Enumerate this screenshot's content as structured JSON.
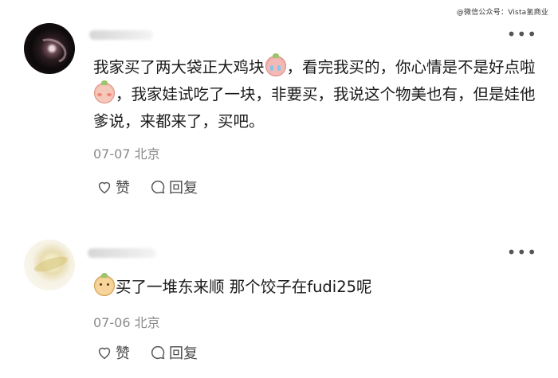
{
  "watermark": "@微信公众号：Vista氢商业",
  "comments": [
    {
      "text_parts": [
        "我家买了两大袋正大鸡块",
        "，看完我买的，你心情是不是好点啦",
        "，我家娃试吃了一块，非要买，我说这个物美也有，但是娃他爹说，来都来了，买吧。"
      ],
      "meta": "07-07 北京",
      "like_label": "赞",
      "reply_label": "回复"
    },
    {
      "text_parts": [
        "买了一堆东来顺 那个饺子在fudi25呢"
      ],
      "meta": "07-06 北京",
      "like_label": "赞",
      "reply_label": "回复"
    }
  ],
  "more_label": "•••",
  "icons": [
    "heart-icon",
    "reply-bubble-icon",
    "more-dots-icon",
    "emoji-cry-icon",
    "emoji-shy-icon",
    "emoji-smile-icon"
  ]
}
